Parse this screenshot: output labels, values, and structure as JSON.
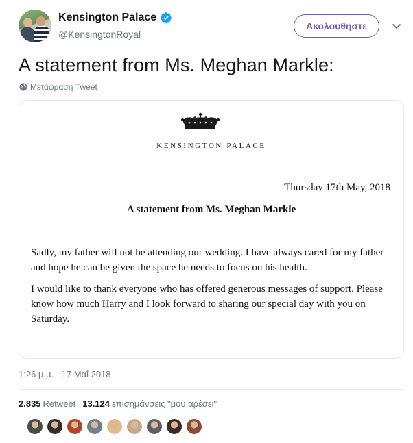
{
  "account": {
    "name": "Kensington Palace",
    "handle": "@KensingtonRoyal"
  },
  "follow_label": "Ακολουθήστε",
  "tweet": {
    "text": "A statement from Ms. Meghan Markle:",
    "translate_label": "Μετάφραση Tweet"
  },
  "document": {
    "org": "KENSINGTON PALACE",
    "date": "Thursday 17th May, 2018",
    "heading": "A statement from Ms. Meghan Markle",
    "paragraph1": "Sadly, my father will not be attending our wedding. I have always cared for my father and hope he can be given the space he needs to focus on his health.",
    "paragraph2": "I would like to thank everyone who has offered generous messages of support. Please know how much Harry and I look forward to sharing our special day with you on Saturday."
  },
  "timestamp": "1:26 μ.μ. - 17 Μαΐ 2018",
  "stats": {
    "retweets_count": "2.835",
    "retweets_label": "Retweet",
    "likes_count": "13.124",
    "likes_label": "επισημάνσεις \"μου αρέσει\""
  },
  "colors": {
    "verified": "#1da1f2",
    "follow_accent": "#7a5ba8",
    "secondary_text": "#657786"
  },
  "liker_avatars": [
    "#4a4a4a",
    "#2f2f2f",
    "#b0452a",
    "#6f7f8c",
    "#e3b98f",
    "#c9a98a",
    "#5d5f66",
    "#3d2a22",
    "#8a4b3b"
  ]
}
